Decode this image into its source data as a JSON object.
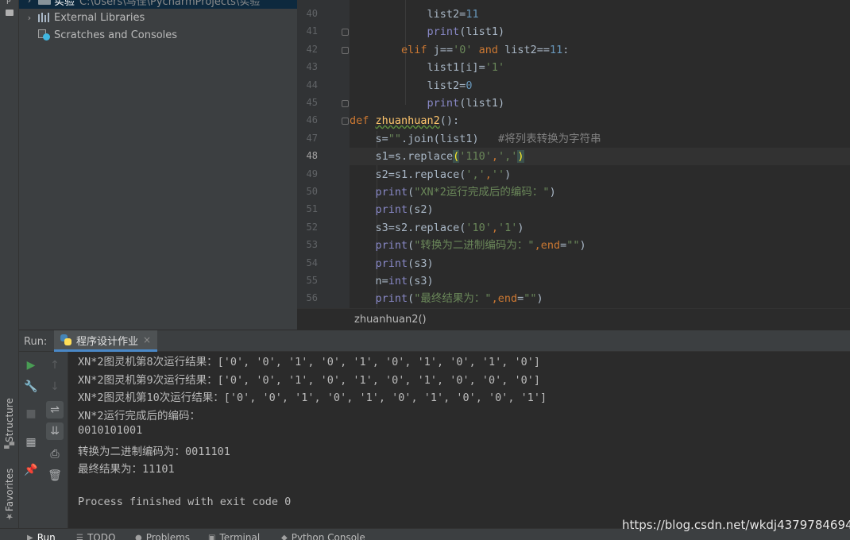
{
  "left_strip": {
    "project_letter": "P",
    "structure_label": "Structure",
    "favorites_label": "Favorites"
  },
  "project_tree": {
    "items": [
      {
        "label": "实验",
        "path": "C:\\Users\\马佳\\PycharmProjects\\实验",
        "icon": "folder-icon"
      },
      {
        "label": "External Libraries",
        "icon": "libraries-icon"
      },
      {
        "label": "Scratches and Consoles",
        "icon": "scratches-icon"
      }
    ]
  },
  "editor": {
    "current_line": 48,
    "lines": [
      {
        "num": "40",
        "tokens": [
          {
            "t": "            list2",
            "c": "plain"
          },
          {
            "t": "=",
            "c": "plain"
          },
          {
            "t": "11",
            "c": "num"
          }
        ]
      },
      {
        "num": "41",
        "tokens": [
          {
            "t": "            ",
            "c": "plain"
          },
          {
            "t": "print",
            "c": "builtin"
          },
          {
            "t": "(list1)",
            "c": "plain"
          }
        ]
      },
      {
        "num": "42",
        "tokens": [
          {
            "t": "        ",
            "c": "plain"
          },
          {
            "t": "elif",
            "c": "kw"
          },
          {
            "t": " j",
            "c": "plain"
          },
          {
            "t": "==",
            "c": "plain"
          },
          {
            "t": "'0'",
            "c": "str"
          },
          {
            "t": " and ",
            "c": "kw"
          },
          {
            "t": "list2",
            "c": "plain"
          },
          {
            "t": "==",
            "c": "plain"
          },
          {
            "t": "11",
            "c": "num"
          },
          {
            "t": ":",
            "c": "plain"
          }
        ]
      },
      {
        "num": "43",
        "tokens": [
          {
            "t": "            list1[i]",
            "c": "plain"
          },
          {
            "t": "=",
            "c": "plain"
          },
          {
            "t": "'1'",
            "c": "str"
          }
        ]
      },
      {
        "num": "44",
        "tokens": [
          {
            "t": "            list2",
            "c": "plain"
          },
          {
            "t": "=",
            "c": "plain"
          },
          {
            "t": "0",
            "c": "num"
          }
        ]
      },
      {
        "num": "45",
        "tokens": [
          {
            "t": "            ",
            "c": "plain"
          },
          {
            "t": "print",
            "c": "builtin"
          },
          {
            "t": "(list1)",
            "c": "plain"
          }
        ]
      },
      {
        "num": "46",
        "tokens": [
          {
            "t": "def ",
            "c": "kw"
          },
          {
            "t": "zhuanhuan2",
            "c": "fn"
          },
          {
            "t": "():",
            "c": "plain"
          }
        ]
      },
      {
        "num": "47",
        "tokens": [
          {
            "t": "    s",
            "c": "plain"
          },
          {
            "t": "=",
            "c": "plain"
          },
          {
            "t": "\"\"",
            "c": "str"
          },
          {
            "t": ".join(list1)   ",
            "c": "plain"
          },
          {
            "t": "#将列表转换为字符串",
            "c": "cmt"
          }
        ]
      },
      {
        "num": "48",
        "tokens": [
          {
            "t": "    s1",
            "c": "plain"
          },
          {
            "t": "=",
            "c": "plain"
          },
          {
            "t": "s.replace",
            "c": "plain"
          },
          {
            "t": "(",
            "c": "match"
          },
          {
            "t": "'110'",
            "c": "str"
          },
          {
            "t": ",",
            "c": "kw"
          },
          {
            "t": "','",
            "c": "str"
          },
          {
            "t": ")",
            "c": "match"
          }
        ]
      },
      {
        "num": "49",
        "tokens": [
          {
            "t": "    s2",
            "c": "plain"
          },
          {
            "t": "=",
            "c": "plain"
          },
          {
            "t": "s1.replace(",
            "c": "plain"
          },
          {
            "t": "','",
            "c": "str"
          },
          {
            "t": ",",
            "c": "kw"
          },
          {
            "t": "''",
            "c": "str"
          },
          {
            "t": ")",
            "c": "plain"
          }
        ]
      },
      {
        "num": "50",
        "tokens": [
          {
            "t": "    ",
            "c": "plain"
          },
          {
            "t": "print",
            "c": "builtin"
          },
          {
            "t": "(",
            "c": "plain"
          },
          {
            "t": "\"XN*2运行完成后的编码：\"",
            "c": "str"
          },
          {
            "t": ")",
            "c": "plain"
          }
        ]
      },
      {
        "num": "51",
        "tokens": [
          {
            "t": "    ",
            "c": "plain"
          },
          {
            "t": "print",
            "c": "builtin"
          },
          {
            "t": "(s2)",
            "c": "plain"
          }
        ]
      },
      {
        "num": "52",
        "tokens": [
          {
            "t": "    s3",
            "c": "plain"
          },
          {
            "t": "=",
            "c": "plain"
          },
          {
            "t": "s2.replace(",
            "c": "plain"
          },
          {
            "t": "'10'",
            "c": "str"
          },
          {
            "t": ",",
            "c": "kw"
          },
          {
            "t": "'1'",
            "c": "str"
          },
          {
            "t": ")",
            "c": "plain"
          }
        ]
      },
      {
        "num": "53",
        "tokens": [
          {
            "t": "    ",
            "c": "plain"
          },
          {
            "t": "print",
            "c": "builtin"
          },
          {
            "t": "(",
            "c": "plain"
          },
          {
            "t": "\"转换为二进制编码为：\"",
            "c": "str"
          },
          {
            "t": ",",
            "c": "kw"
          },
          {
            "t": "end",
            "c": "kw"
          },
          {
            "t": "=",
            "c": "plain"
          },
          {
            "t": "\"\"",
            "c": "str"
          },
          {
            "t": ")",
            "c": "plain"
          }
        ]
      },
      {
        "num": "54",
        "tokens": [
          {
            "t": "    ",
            "c": "plain"
          },
          {
            "t": "print",
            "c": "builtin"
          },
          {
            "t": "(s3)",
            "c": "plain"
          }
        ]
      },
      {
        "num": "55",
        "tokens": [
          {
            "t": "    n",
            "c": "plain"
          },
          {
            "t": "=",
            "c": "plain"
          },
          {
            "t": "int",
            "c": "builtin"
          },
          {
            "t": "(s3)",
            "c": "plain"
          }
        ]
      },
      {
        "num": "56",
        "tokens": [
          {
            "t": "    ",
            "c": "plain"
          },
          {
            "t": "print",
            "c": "builtin"
          },
          {
            "t": "(",
            "c": "plain"
          },
          {
            "t": "\"最终结果为：\"",
            "c": "str"
          },
          {
            "t": ",",
            "c": "kw"
          },
          {
            "t": "end",
            "c": "kw"
          },
          {
            "t": "=",
            "c": "plain"
          },
          {
            "t": "\"\"",
            "c": "str"
          },
          {
            "t": ")",
            "c": "plain"
          }
        ]
      }
    ]
  },
  "breadcrumb": {
    "text": "zhuanhuan2()"
  },
  "run_panel": {
    "label": "Run:",
    "tab_title": "程序设计作业",
    "tab_close": "×",
    "console_lines": [
      "XN*2图灵机第8次运行结果：['0', '0', '1', '0', '1', '0', '1', '0', '1', '0']",
      "XN*2图灵机第9次运行结果：['0', '0', '1', '0', '1', '0', '1', '0', '0', '0']",
      "XN*2图灵机第10次运行结果：['0', '0', '1', '0', '1', '0', '1', '0', '0', '1']",
      "XN*2运行完成后的编码：",
      "0010101001",
      "转换为二进制编码为：0011101",
      "最终结果为：11101",
      "",
      "Process finished with exit code 0"
    ]
  },
  "bottom_tabs": [
    {
      "label": "Run",
      "icon": "play-icon"
    },
    {
      "label": "TODO",
      "icon": "list-icon"
    },
    {
      "label": "Problems",
      "icon": "info-icon"
    },
    {
      "label": "Terminal",
      "icon": "terminal-icon"
    },
    {
      "label": "Python Console",
      "icon": "python-icon"
    }
  ],
  "watermark": {
    "text": "https://blog.csdn.net/wkdj43797846949"
  }
}
